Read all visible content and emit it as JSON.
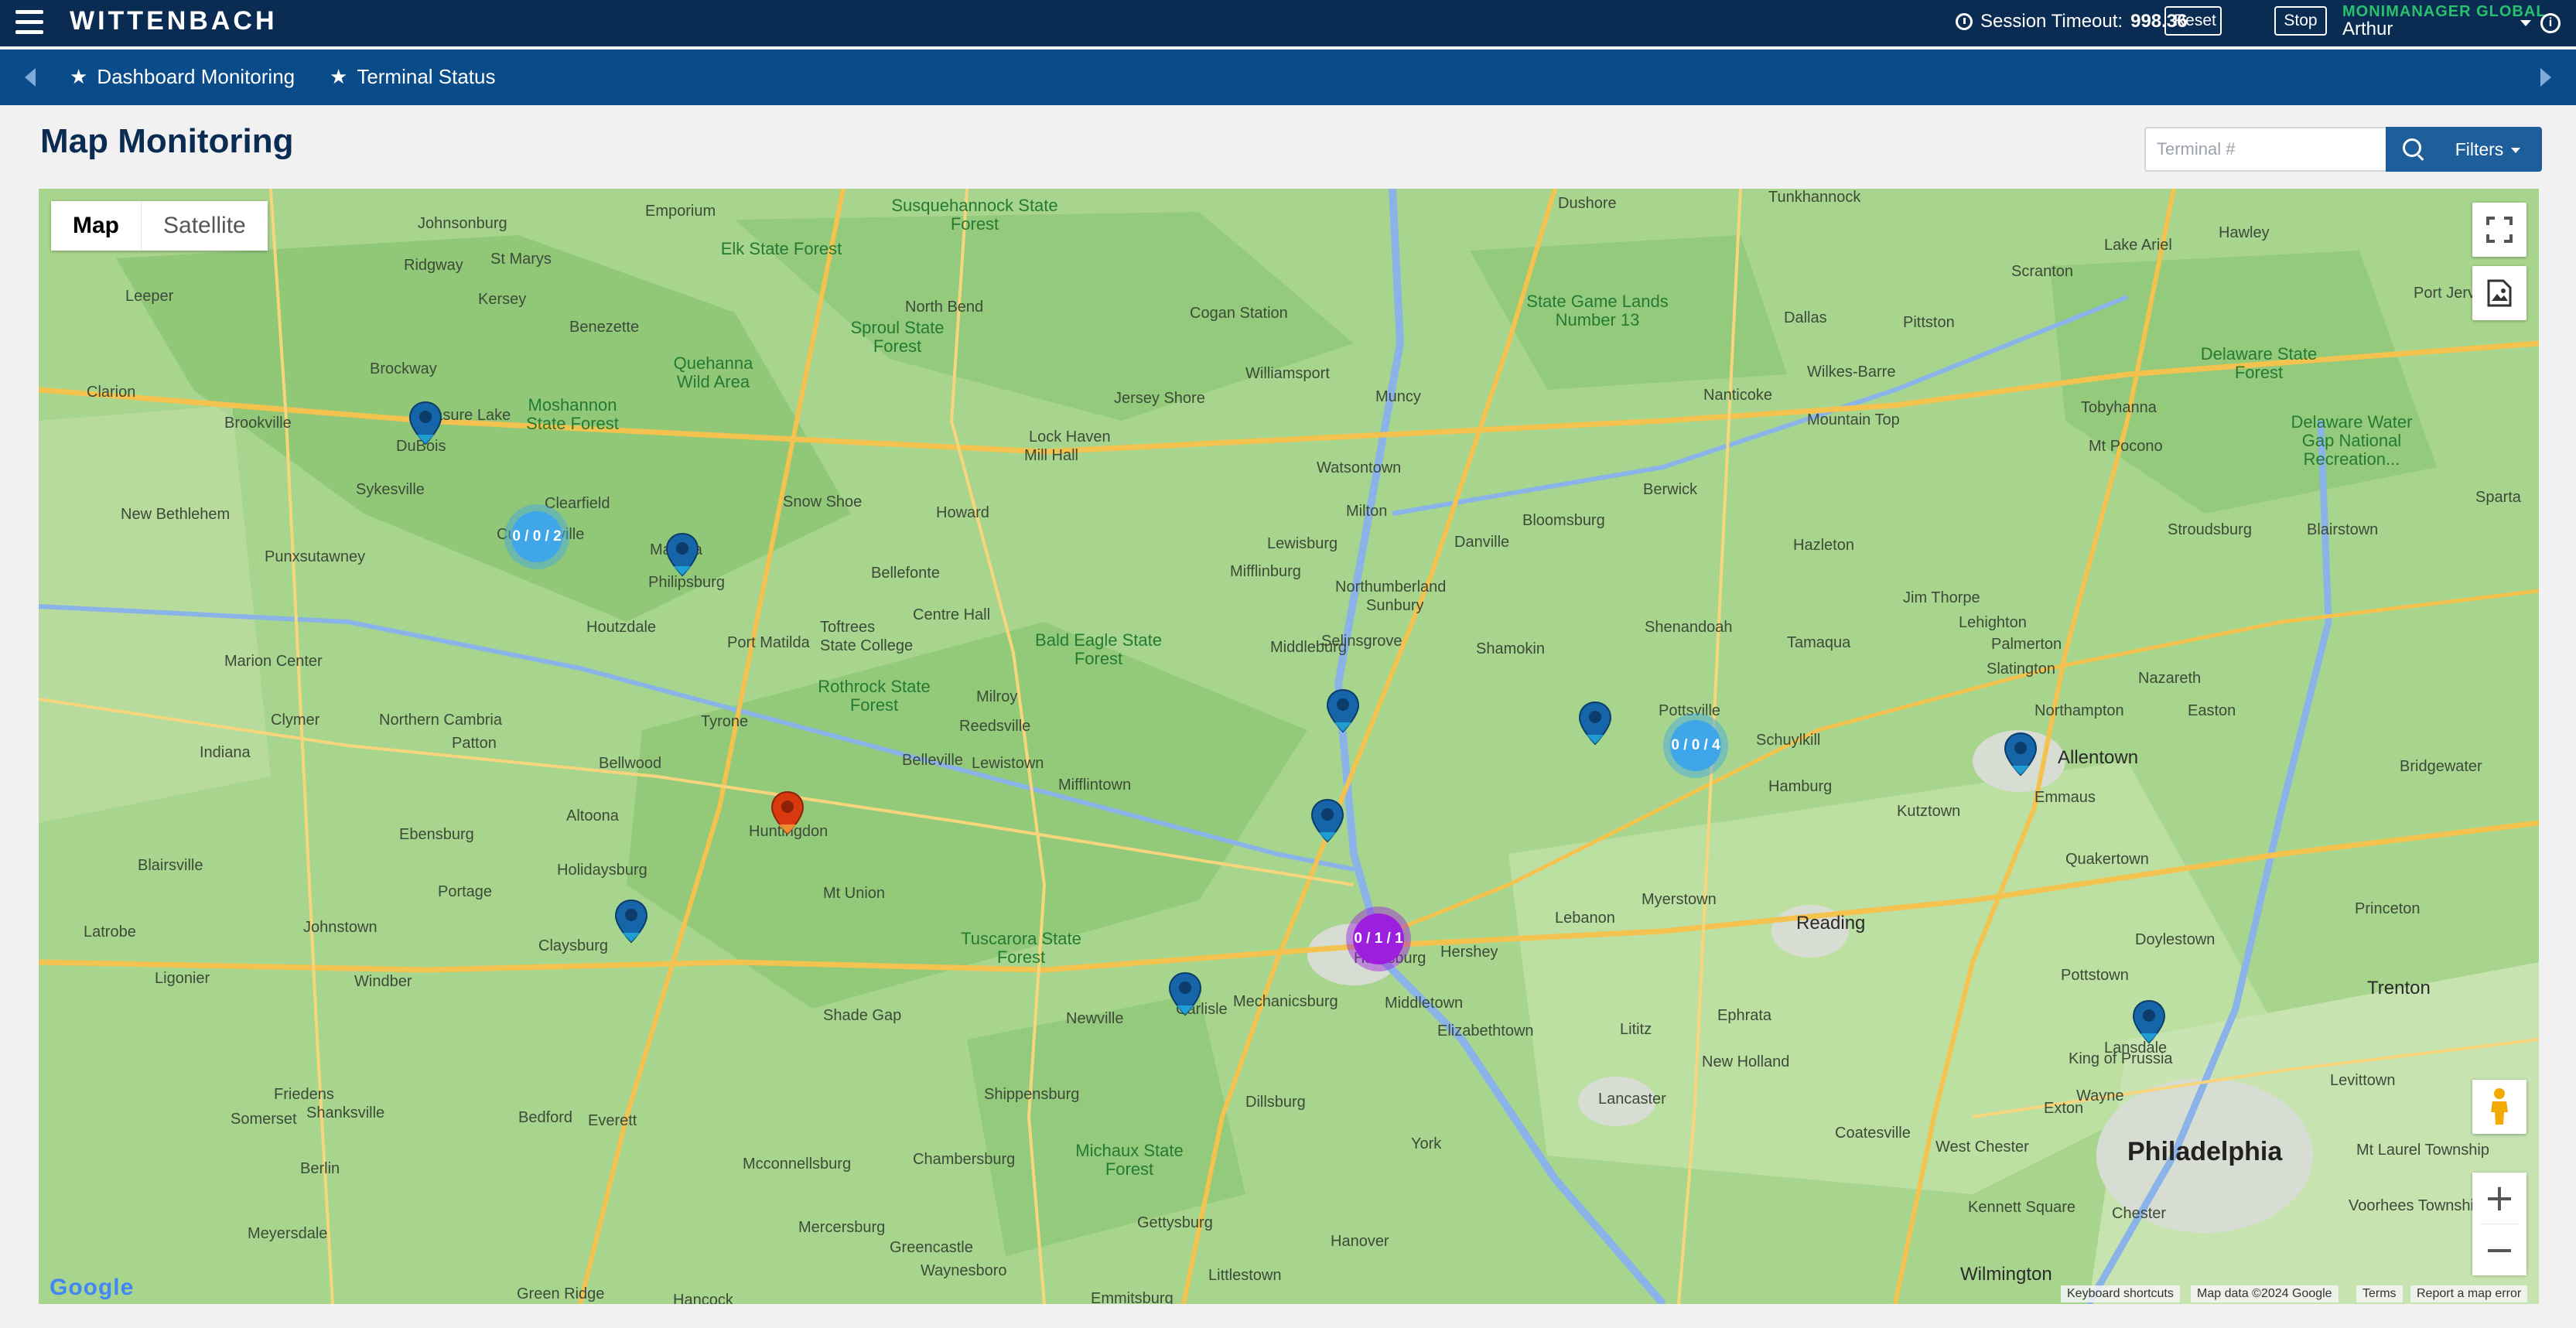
{
  "app": {
    "logo": "WITTENBACH",
    "session_label": "Session Timeout:",
    "session_value": "998.36",
    "reset_label": "Reset",
    "stop_label": "Stop",
    "user_org": "MONIMANAGER GLOBAL",
    "user_name": "Arthur",
    "info_glyph": "i"
  },
  "nav": {
    "tabs": [
      {
        "label": "Dashboard Monitoring",
        "icon": "star-icon"
      },
      {
        "label": "Terminal Status",
        "icon": "star-icon"
      }
    ]
  },
  "page": {
    "title": "Map Monitoring",
    "search_placeholder": "Terminal #",
    "filters_label": "Filters"
  },
  "map": {
    "type_options": [
      "Map",
      "Satellite"
    ],
    "selected_type": "Map",
    "zoom_in": "+",
    "zoom_out": "−",
    "clusters": [
      {
        "label": "0 / 0 / 2",
        "color": "#3fa6ea"
      },
      {
        "label": "0 / 0 / 4",
        "color": "#3fa6ea"
      },
      {
        "label": "0 / 1 / 1",
        "color": "#9b1fdc"
      }
    ],
    "pin_colors": {
      "normal": "#1565a8",
      "alert": "#d9390f"
    },
    "places": [
      "Johnsonburg",
      "Ridgway",
      "St Marys",
      "Emporium",
      "Kersey",
      "Leeper",
      "Benezette",
      "Brockway",
      "Clarion",
      "Brookville",
      "Treasure Lake",
      "DuBois",
      "Sykesville",
      "New Bethlehem",
      "Punxsutawney",
      "Clearfield",
      "Curwensville",
      "Madera",
      "Philipsburg",
      "Houtzdale",
      "Marion Center",
      "Clymer",
      "Indiana",
      "Northern Cambria",
      "Patton",
      "Bellwood",
      "Altoona",
      "Ebensburg",
      "Holidaysburg",
      "Blairsville",
      "Portage",
      "Johnstown",
      "Claysburg",
      "Latrobe",
      "Ligonier",
      "Windber",
      "Friedens",
      "Somerset",
      "Shanksville",
      "Berlin",
      "Bedford",
      "Everett",
      "Meyersdale",
      "Green Ridge",
      "Hancock",
      "Elk State Forest",
      "Quehanna Wild Area",
      "Moshannon State Forest",
      "Susquehannock State Forest",
      "Sproul State Forest",
      "North Bend",
      "Cogan Station",
      "Jersey Shore",
      "Lock Haven",
      "Mill Hall",
      "Snow Shoe",
      "Howard",
      "Bellefonte",
      "Port Matilda",
      "Toftrees",
      "State College",
      "Centre Hall",
      "Milroy",
      "Reedsville",
      "Lewistown",
      "Belleville",
      "Tyrone",
      "Rothrock State Forest",
      "Bald Eagle State Forest",
      "Huntingdon",
      "Mt Union",
      "Mifflintown",
      "Tuscarora State Forest",
      "Shade Gap",
      "Newville",
      "Shippensburg",
      "Chambersburg",
      "Mcconnellsburg",
      "Mercersburg",
      "Greencastle",
      "Waynesboro",
      "Emmitsburg",
      "Michaux State Forest",
      "Gettysburg",
      "Littlestown",
      "Dillsburg",
      "Carlisle",
      "Mechanicsburg",
      "Harrisburg",
      "Hershey",
      "Middletown",
      "Elizabethtown",
      "Hanover",
      "York",
      "Williamsport",
      "Muncy",
      "Watsontown",
      "Milton",
      "Lewisburg",
      "Mifflinburg",
      "Northumberland",
      "Sunbury",
      "Selinsgrove",
      "Middleburg",
      "Danville",
      "Bloomsburg",
      "Berwick",
      "Shamokin",
      "Dushore",
      "State Game Lands Number 13",
      "Dallas",
      "Pittston",
      "Wilkes-Barre",
      "Nanticoke",
      "Mountain Top",
      "Hazleton",
      "Shenandoah",
      "Tamaqua",
      "Pottsville",
      "Schuylkill",
      "Hamburg",
      "Kutztown",
      "Myerstown",
      "Lebanon",
      "Reading",
      "Lititz",
      "Ephrata",
      "New Holland",
      "Lancaster",
      "Coatesville",
      "West Chester",
      "Kennett Square",
      "Wilmington",
      "Pottstown",
      "Lansdale",
      "King of Prussia",
      "Wayne",
      "Philadelphia",
      "Chester",
      "Mt Laurel Township",
      "Voorhees Township",
      "Levittown",
      "Trenton",
      "Doylestown",
      "Quakertown",
      "Princeton",
      "Bridgewater",
      "Emmaus",
      "Allentown",
      "Northampton",
      "Slatington",
      "Palmerton",
      "Lehighton",
      "Jim Thorpe",
      "Easton",
      "Nazareth",
      "Stroudsburg",
      "Blairstown",
      "Sparta",
      "Mt Pocono",
      "Tobyhanna",
      "Scranton",
      "Lake Ariel",
      "Hawley",
      "Tunkhannock",
      "Port Jervis",
      "Delaware State Forest",
      "Delaware Water Gap National Recreation...",
      "Exton"
    ],
    "google_logo": "Google",
    "attribution": {
      "shortcuts": "Keyboard shortcuts",
      "data": "Map data ©2024 Google",
      "terms": "Terms",
      "report": "Report a map error"
    }
  }
}
